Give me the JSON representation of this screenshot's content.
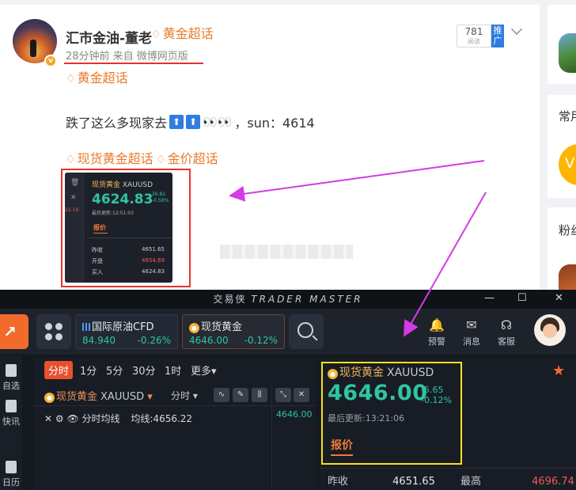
{
  "post": {
    "author": "汇市金油-董老",
    "author_tag": "黄金超话",
    "meta": "28分钟前 来自 微博网页版",
    "views": "781",
    "views_sub": "阅读",
    "promo": "推广",
    "topic_tag": "黄金超话",
    "text_start": "跌了这么多现家去",
    "text_end": "，sun：4614",
    "emoji_eyes": "👀👀",
    "extra_tags": "现货黄金超话",
    "extra_tags2": "金价超话",
    "thumb": {
      "name": "现货黄金",
      "code": "XAUUSD",
      "price": "4624.83",
      "change": "26.82",
      "pct": "-0.58%",
      "update": "最后更新:12:51:03",
      "tab": "报价",
      "side_red": "22.19",
      "rows": [
        {
          "k": "昨收",
          "v": "4651.65"
        },
        {
          "k": "开盘",
          "v": "4654.69"
        },
        {
          "k": "买入",
          "v": "4624.83"
        }
      ]
    }
  },
  "right_col": {
    "t1": "常用",
    "t2": "粉丝"
  },
  "app": {
    "title_cn": "交易侠",
    "title_en": "TRADER MASTER",
    "tabs": [
      {
        "name": "国际原油CFD",
        "price": "84.940",
        "pct": "-0.26%"
      },
      {
        "name": "现货黄金",
        "price": "4646.00",
        "pct": "-0.12%"
      }
    ],
    "tools": [
      {
        "label": "预警"
      },
      {
        "label": "消息"
      },
      {
        "label": "客服"
      }
    ],
    "nav": [
      {
        "label": "自选"
      },
      {
        "label": "快讯"
      },
      {
        "label": "日历"
      }
    ],
    "periods": [
      "分时",
      "1分",
      "5分",
      "30分",
      "1时",
      "更多"
    ],
    "chart": {
      "name": "现货黄金",
      "code": "XAUUSD",
      "mode": "分时",
      "ma_label": "分时均线",
      "ma_value": "均线:4656.22",
      "axis_price": "4646.00"
    },
    "quote": {
      "name": "现货黄金",
      "code": "XAUUSD",
      "price": "4646.00",
      "change": "-5.65",
      "pct": "-0.12%",
      "update": "最后更新:13:21:06",
      "tab": "报价",
      "prev_close_label": "昨收",
      "prev_close": "4651.65",
      "high_label": "最高",
      "high": "4696.74"
    }
  },
  "colors": {
    "accent_orange": "#f26b2c",
    "up_green": "#2fc5a0",
    "down_red": "#f05a5a",
    "highlight_yellow": "#f4e21c",
    "highlight_red": "#e5322d",
    "arrow_magenta": "#d33be6"
  }
}
